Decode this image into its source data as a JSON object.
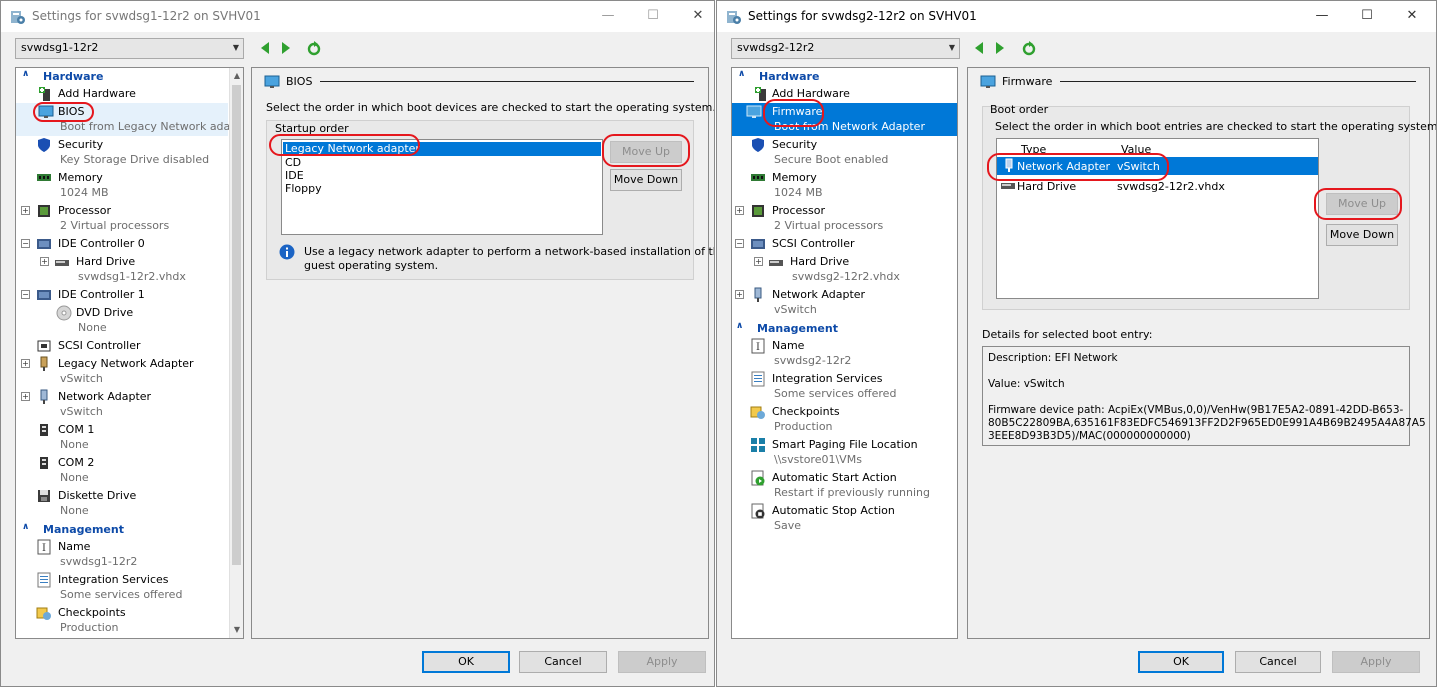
{
  "left": {
    "title": "Settings for svwdsg1-12r2 on SVHV01",
    "vm_selected": "svwdsg1-12r2",
    "hardware_header": "Hardware",
    "management_header": "Management",
    "hardware": [
      {
        "label": "Add Hardware"
      },
      {
        "label": "BIOS",
        "sub": "Boot from Legacy Network ada..."
      },
      {
        "label": "Security",
        "sub": "Key Storage Drive disabled"
      },
      {
        "label": "Memory",
        "sub": "1024 MB"
      },
      {
        "label": "Processor",
        "sub": "2 Virtual processors"
      },
      {
        "label": "IDE Controller 0"
      },
      {
        "label": "Hard Drive",
        "sub": "svwdsg1-12r2.vhdx"
      },
      {
        "label": "IDE Controller 1"
      },
      {
        "label": "DVD Drive",
        "sub": "None"
      },
      {
        "label": "SCSI Controller"
      },
      {
        "label": "Legacy Network Adapter",
        "sub": "vSwitch"
      },
      {
        "label": "Network Adapter",
        "sub": "vSwitch"
      },
      {
        "label": "COM 1",
        "sub": "None"
      },
      {
        "label": "COM 2",
        "sub": "None"
      },
      {
        "label": "Diskette Drive",
        "sub": "None"
      }
    ],
    "management": [
      {
        "label": "Name",
        "sub": "svwdsg1-12r2"
      },
      {
        "label": "Integration Services",
        "sub": "Some services offered"
      },
      {
        "label": "Checkpoints",
        "sub": "Production"
      }
    ],
    "pane": {
      "heading": "BIOS",
      "description": "Select the order in which boot devices are checked to start the operating system.",
      "group_label": "Startup order",
      "boot_items": [
        "Legacy Network adapter",
        "CD",
        "IDE",
        "Floppy"
      ],
      "move_up": "Move Up",
      "move_down": "Move Down",
      "info_line1": "Use a legacy network adapter to perform a network-based installation of the",
      "info_line2": "guest operating system."
    },
    "buttons": {
      "ok": "OK",
      "cancel": "Cancel",
      "apply": "Apply"
    }
  },
  "right": {
    "title": "Settings for svwdsg2-12r2 on SVHV01",
    "vm_selected": "svwdsg2-12r2",
    "hardware_header": "Hardware",
    "management_header": "Management",
    "hardware": [
      {
        "label": "Add Hardware"
      },
      {
        "label": "Firmware",
        "sub": "Boot from Network Adapter"
      },
      {
        "label": "Security",
        "sub": "Secure Boot enabled"
      },
      {
        "label": "Memory",
        "sub": "1024 MB"
      },
      {
        "label": "Processor",
        "sub": "2 Virtual processors"
      },
      {
        "label": "SCSI Controller"
      },
      {
        "label": "Hard Drive",
        "sub": "svwdsg2-12r2.vhdx"
      },
      {
        "label": "Network Adapter",
        "sub": "vSwitch"
      }
    ],
    "management": [
      {
        "label": "Name",
        "sub": "svwdsg2-12r2"
      },
      {
        "label": "Integration Services",
        "sub": "Some services offered"
      },
      {
        "label": "Checkpoints",
        "sub": "Production"
      },
      {
        "label": "Smart Paging File Location",
        "sub": "\\\\svstore01\\VMs"
      },
      {
        "label": "Automatic Start Action",
        "sub": "Restart if previously running"
      },
      {
        "label": "Automatic Stop Action",
        "sub": "Save"
      }
    ],
    "pane": {
      "heading": "Firmware",
      "group_label": "Boot order",
      "description": "Select the order in which boot entries are checked to start the operating system.",
      "col_type": "Type",
      "col_value": "Value",
      "entries": [
        {
          "type": "Network Adapter",
          "value": "vSwitch"
        },
        {
          "type": "Hard Drive",
          "value": "svwdsg2-12r2.vhdx"
        }
      ],
      "move_up": "Move Up",
      "move_down": "Move Down",
      "details_label": "Details for selected boot entry:",
      "details_desc": "Description: EFI Network",
      "details_value": "Value: vSwitch",
      "details_path1": "Firmware device path: AcpiEx(VMBus,0,0)/VenHw(9B17E5A2-0891-42DD-B653-",
      "details_path2": "80B5C22809BA,635161F83EDFC546913FF2D2F965ED0E991A4B69B2495A4A87A5",
      "details_path3": "3EEE8D93B3D5)/MAC(000000000000)"
    },
    "buttons": {
      "ok": "OK",
      "cancel": "Cancel",
      "apply": "Apply"
    }
  },
  "colors": {
    "selection": "#0078d7",
    "section": "#0d4aa8",
    "highlight_ring": "#e5171d"
  }
}
